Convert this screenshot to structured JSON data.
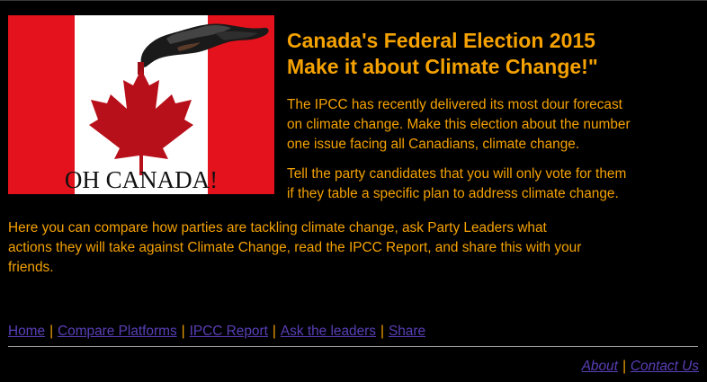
{
  "hero": {
    "caption": "OH CANADA!",
    "colors": {
      "red": "#e3121c",
      "white": "#ffffff",
      "leaf": "#b8101a",
      "smoke": "#1a1a1a"
    }
  },
  "headline": {
    "line1": "Canada's Federal Election 2015",
    "line2": "Make it about Climate Change!\""
  },
  "intro": {
    "line1": "The IPCC has recently delivered its most dour forecast",
    "line2": "on climate change. Make this election about the number",
    "line3": "one issue facing all Canadians, climate change."
  },
  "vote": {
    "line1": "Tell the party candidates that you will only vote for them",
    "line2": "if they table a specific plan to address climate change."
  },
  "compare": {
    "line1": "Here you can compare how parties are tackling climate change, ask Party Leaders what",
    "line2": "actions they will take against Climate Change, read the IPCC Report, and share this with your",
    "line3": "friends."
  },
  "nav": {
    "items": [
      "Home",
      "Compare Platforms",
      "IPCC Report",
      "Ask the leaders",
      "Share"
    ],
    "separator": "|"
  },
  "footer": {
    "about": "About",
    "contact": "Contact Us",
    "separator": "|"
  },
  "colors": {
    "background": "#000000",
    "text": "#f5a200",
    "link": "#5a3fb8",
    "divider": "#9a9a9a"
  }
}
